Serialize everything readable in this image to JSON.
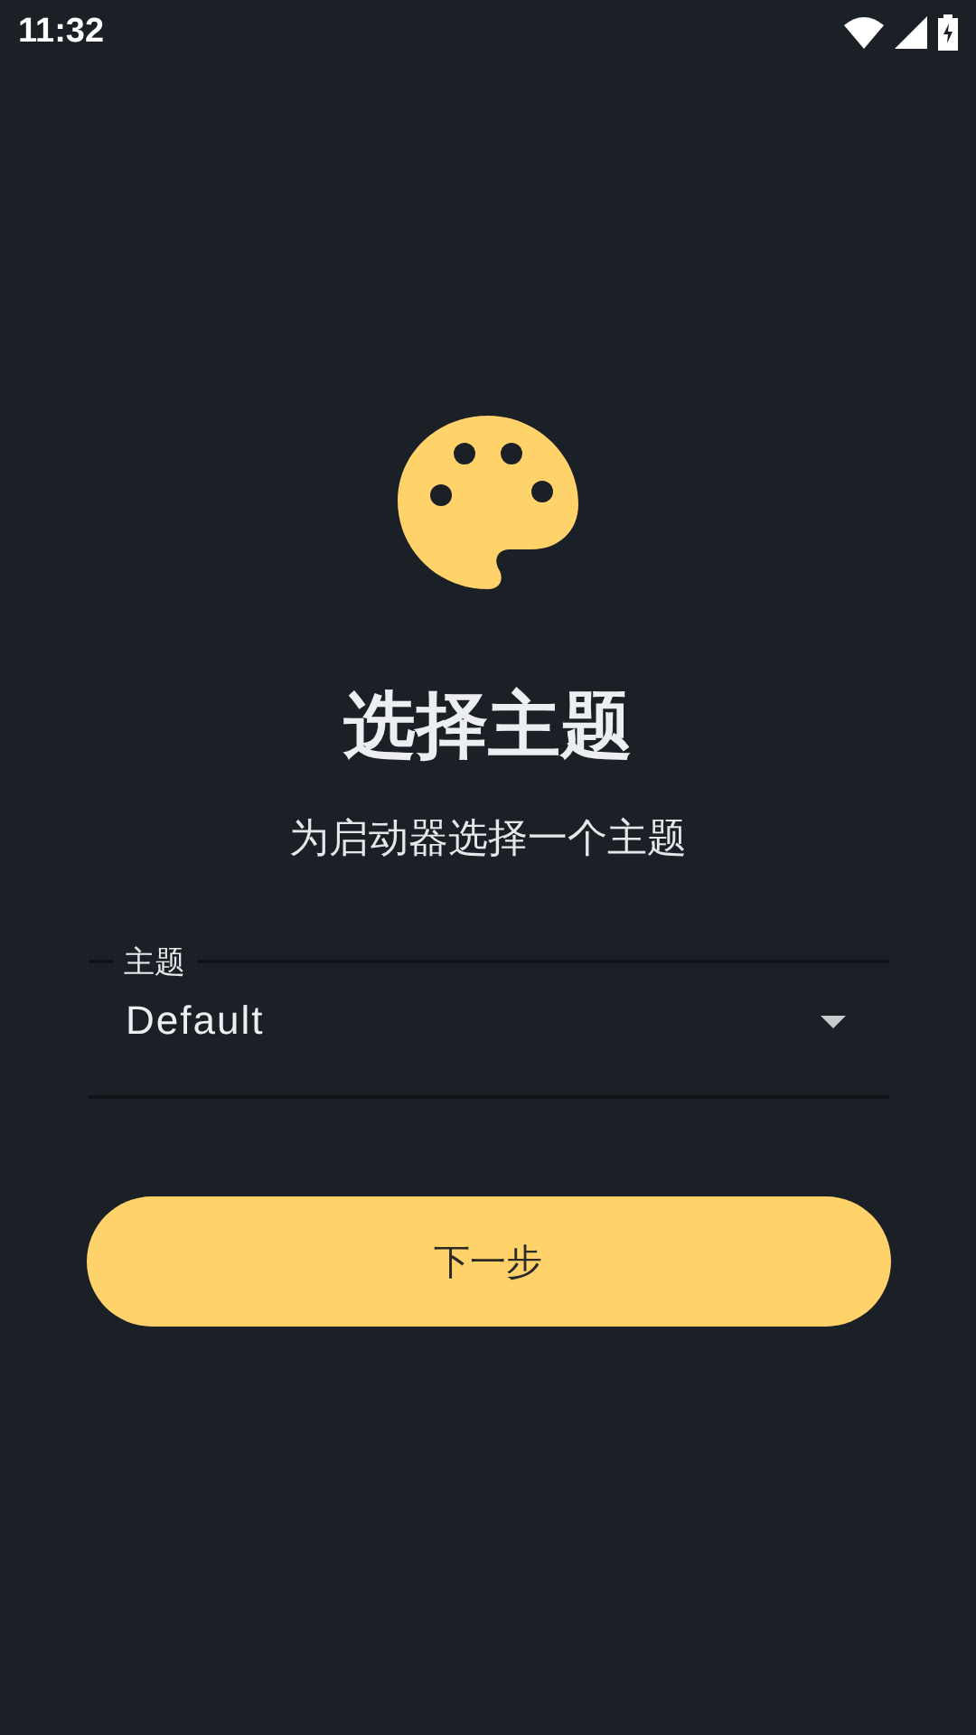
{
  "status_bar": {
    "time": "11:32"
  },
  "title": "选择主题",
  "subtitle": "为启动器选择一个主题",
  "theme_field": {
    "label": "主题",
    "value": "Default"
  },
  "next_button": {
    "label": "下一步"
  }
}
